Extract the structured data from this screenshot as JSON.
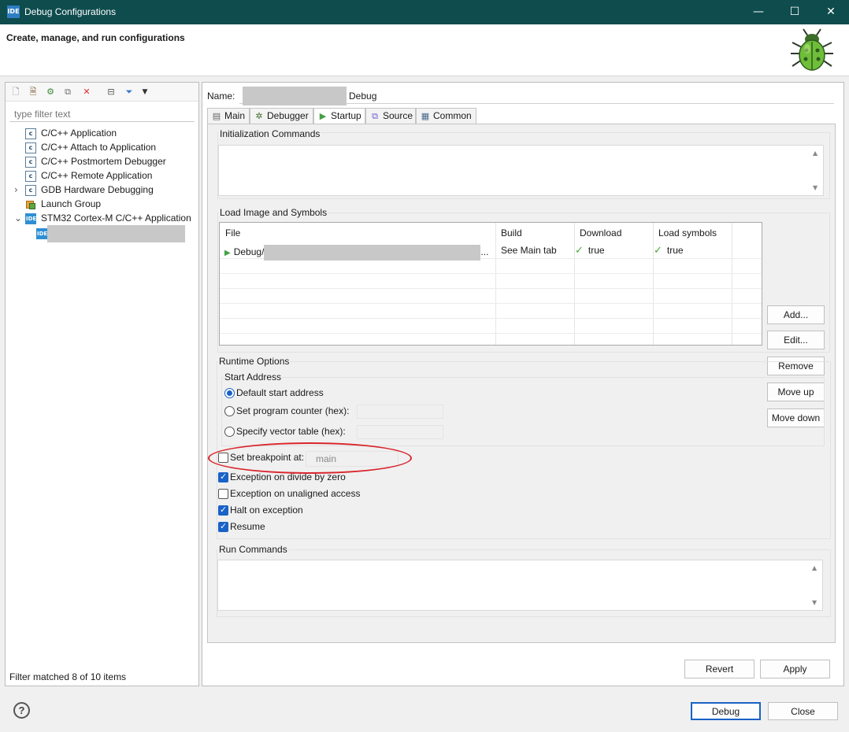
{
  "window": {
    "app_icon": "IDE",
    "title": "Debug Configurations",
    "minimize": "—",
    "maximize": "☐",
    "close": "✕"
  },
  "banner": {
    "heading": "Create, manage, and run configurations"
  },
  "left": {
    "filter_placeholder": "type filter text",
    "tree": [
      {
        "icon": "c",
        "label": "C/C++ Application"
      },
      {
        "icon": "c",
        "label": "C/C++ Attach to Application"
      },
      {
        "icon": "c",
        "label": "C/C++ Postmortem Debugger"
      },
      {
        "icon": "c",
        "label": "C/C++ Remote Application"
      },
      {
        "icon": "c",
        "label": "GDB Hardware Debugging",
        "expander": "›"
      },
      {
        "icon": "",
        "label": "Launch Group"
      },
      {
        "icon": "IDE",
        "label": "STM32 Cortex-M C/C++ Application",
        "expander": "⌄"
      }
    ],
    "child_icon": "IDE",
    "status": "Filter matched 8 of 10 items"
  },
  "config": {
    "name_label": "Name:",
    "name_suffix": "Debug"
  },
  "tabs": [
    {
      "label": "Main",
      "icon": "▤"
    },
    {
      "label": "Debugger",
      "icon": "✲"
    },
    {
      "label": "Startup",
      "icon": "▶"
    },
    {
      "label": "Source",
      "icon": "⧉"
    },
    {
      "label": "Common",
      "icon": "▦"
    }
  ],
  "startup": {
    "init_commands_label": "Initialization Commands",
    "load_image_label": "Load Image and Symbols",
    "table": {
      "headers": [
        "File",
        "Build",
        "Download",
        "Load symbols"
      ],
      "row": {
        "file": "Debug/",
        "file_tail": "...",
        "build": "See Main tab",
        "download": "true",
        "load_symbols": "true"
      }
    },
    "buttons": [
      "Add...",
      "Edit...",
      "Remove",
      "Move up",
      "Move down"
    ],
    "runtime_label": "Runtime Options",
    "start_address_label": "Start Address",
    "radios": [
      {
        "label": "Default start address",
        "checked": true
      },
      {
        "label": "Set program counter (hex):",
        "checked": false
      },
      {
        "label": "Specify vector table (hex):",
        "checked": false
      }
    ],
    "breakpoint": {
      "label": "Set breakpoint at:",
      "value": "main",
      "checked": false
    },
    "checkboxes": [
      {
        "label": "Exception on divide by zero",
        "checked": true
      },
      {
        "label": "Exception on unaligned access",
        "checked": false
      },
      {
        "label": "Halt on exception",
        "checked": true
      },
      {
        "label": "Resume",
        "checked": true
      }
    ],
    "run_commands_label": "Run Commands"
  },
  "actions": {
    "revert": "Revert",
    "apply": "Apply",
    "debug": "Debug",
    "close": "Close",
    "help": "?"
  },
  "colors": {
    "titlebar": "#0f4c4e",
    "accent": "#1a62c7",
    "highlight": "#d9262c"
  }
}
